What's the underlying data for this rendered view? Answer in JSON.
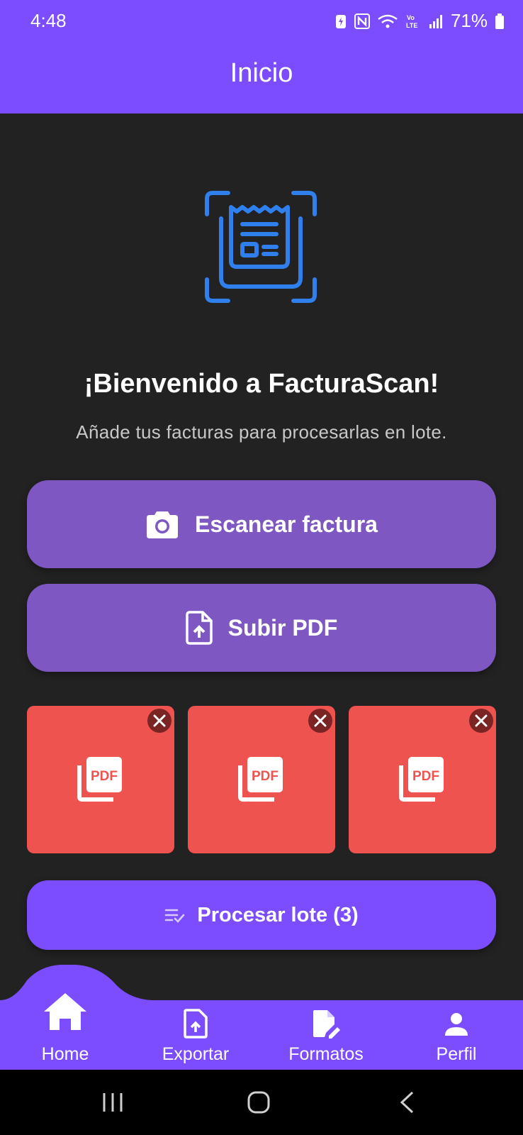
{
  "status_bar": {
    "time": "4:48",
    "battery": "71%",
    "icons": [
      "battery-saver-icon",
      "nfc-icon",
      "wifi-icon",
      "volte-icon",
      "signal-icon",
      "battery-icon"
    ]
  },
  "app_bar": {
    "title": "Inicio"
  },
  "hero": {
    "icon": "receipt-scan-icon",
    "accent_color": "#2f80ed"
  },
  "welcome": {
    "title": "¡Bienvenido a FacturaScan!",
    "subtitle": "Añade tus facturas para procesarlas en lote."
  },
  "actions": {
    "scan_label": "Escanear factura",
    "scan_icon": "camera-icon",
    "upload_label": "Subir PDF",
    "upload_icon": "file-upload-icon"
  },
  "files": [
    {
      "type": "PDF",
      "icon": "pdf-icon",
      "remove_icon": "close-icon"
    },
    {
      "type": "PDF",
      "icon": "pdf-icon",
      "remove_icon": "close-icon"
    },
    {
      "type": "PDF",
      "icon": "pdf-icon",
      "remove_icon": "close-icon"
    }
  ],
  "process": {
    "label": "Procesar lote (3)",
    "icon": "checklist-icon"
  },
  "bottom_nav": {
    "items": [
      {
        "label": "Home",
        "icon": "home-icon",
        "active": true
      },
      {
        "label": "Exportar",
        "icon": "export-icon"
      },
      {
        "label": "Formatos",
        "icon": "edit-document-icon"
      },
      {
        "label": "Perfil",
        "icon": "person-icon"
      }
    ]
  },
  "colors": {
    "primary": "#7c4dff",
    "button": "#7e57c2",
    "background": "#222222",
    "file_tile": "#ef5350"
  }
}
